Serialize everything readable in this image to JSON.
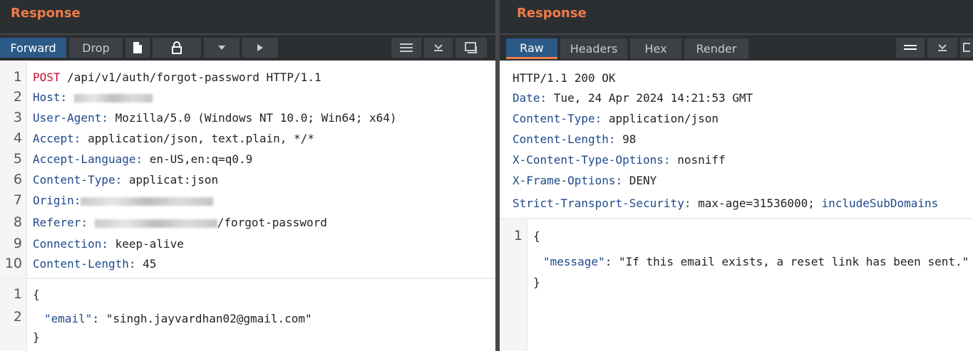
{
  "left": {
    "title": "Response",
    "toolbar": {
      "forward_label": "Forward",
      "drop_label": "Drop"
    },
    "request_line": {
      "method": "POST",
      "rest": " /api/v1/auth/forgot-password HTTP/1.1"
    },
    "headers": [
      {
        "name": "Host",
        "value": ""
      },
      {
        "name": "User-Agent",
        "value": " Mozilla/5.0 (Windows NT 10.0; Win64; x64)"
      },
      {
        "name": "Accept",
        "value": " application/json, text.plain, */*"
      },
      {
        "name": "Accept-Language",
        "value": " en-US,en:q=q0.9"
      },
      {
        "name": "Content-Type",
        "value": " applicat:json"
      },
      {
        "name": "Origin",
        "value": ""
      },
      {
        "name": "Referer",
        "value": "/forgot-password"
      },
      {
        "name": "Connection",
        "value": " keep-alive"
      },
      {
        "name": "Content-Length",
        "value": " 45"
      }
    ],
    "line_numbers": [
      "1",
      "2",
      "3",
      "4",
      "5",
      "6",
      "7",
      "8",
      "9",
      "10"
    ],
    "body": {
      "line_numbers": [
        "1",
        "2"
      ],
      "open": "{",
      "key": "\"email\"",
      "colon": ": ",
      "value": "\"singh.jayvardhan02@gmail.com\"",
      "close": "}"
    }
  },
  "right": {
    "title": "Response",
    "tabs": [
      "Raw",
      "Headers",
      "Hex",
      "Render"
    ],
    "status_line": "HTTP/1.1 200 OK",
    "headers": [
      {
        "name": "Date",
        "value": " Tue, 24 Apr 2024 14:21:53 GMT"
      },
      {
        "name": "Content-Type",
        "value": " application/json"
      },
      {
        "name": "Content-Length",
        "value": " 98"
      },
      {
        "name": "X-Content-Type-Options",
        "value": " nosniff"
      },
      {
        "name": "X-Frame-Options",
        "value": " DENY"
      },
      {
        "name": "Strict-Transport-Security",
        "value": " max-age=31536000;",
        "extra": " includeSubDomains"
      }
    ],
    "body": {
      "line_numbers": [
        "1"
      ],
      "open": "{",
      "key": "\"message\"",
      "colon": ": ",
      "value": "\"If this email exists, a reset link has been sent.\"",
      "close": "}"
    }
  },
  "icons": {
    "toolbar_left": [
      "document-icon",
      "lock-icon",
      "dropdown-icon",
      "play-icon"
    ],
    "toolbar_right": [
      "menu-icon",
      "collapse-icon",
      "window-icon"
    ]
  },
  "colors": {
    "accent": "#f07b4a",
    "active_tab": "#2b5a87",
    "header_key": "#1e4a8c",
    "method": "#c8102e"
  }
}
